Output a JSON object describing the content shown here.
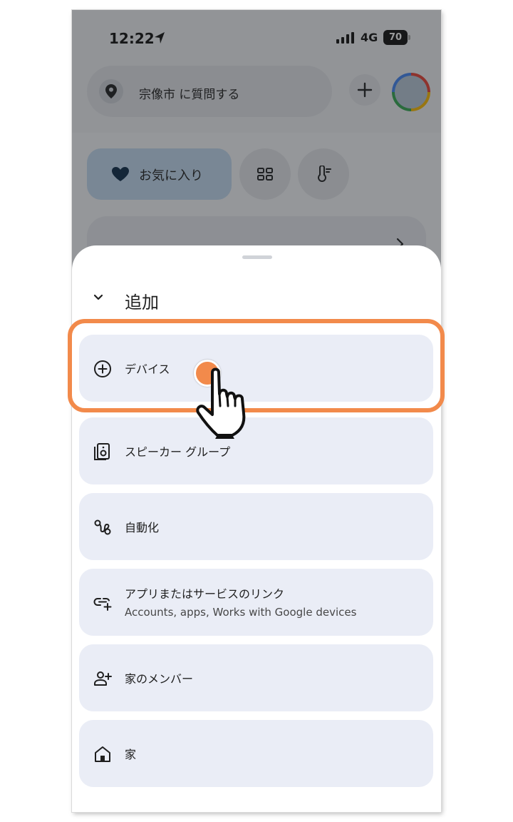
{
  "status_bar": {
    "time": "12:22",
    "network": "4G",
    "battery": "70",
    "icons": [
      "location-arrow-icon",
      "signal-bars-icon",
      "battery-icon"
    ]
  },
  "header": {
    "ask_placeholder": "宗像市 に質問する",
    "icons": [
      "location-pin-icon",
      "plus-icon",
      "account-avatar"
    ]
  },
  "filters": {
    "favorites_label": "お気に入り",
    "icons": [
      "heart-icon",
      "grid-icon",
      "thermostat-icon"
    ]
  },
  "sheet": {
    "title": "追加",
    "options": [
      {
        "label": "デバイス",
        "icon": "add-circle-icon"
      },
      {
        "label": "スピーカー グループ",
        "icon": "speaker-icon"
      },
      {
        "label": "自動化",
        "icon": "automation-icon"
      },
      {
        "label": "アプリまたはサービスのリンク",
        "sublabel": "Accounts, apps, Works with Google devices",
        "icon": "link-add-icon"
      },
      {
        "label": "家のメンバー",
        "icon": "add-person-icon"
      },
      {
        "label": "家",
        "icon": "home-icon"
      }
    ]
  },
  "annotation": {
    "highlight_color": "#f28a4b",
    "pointer": "hand-pointer-icon"
  }
}
